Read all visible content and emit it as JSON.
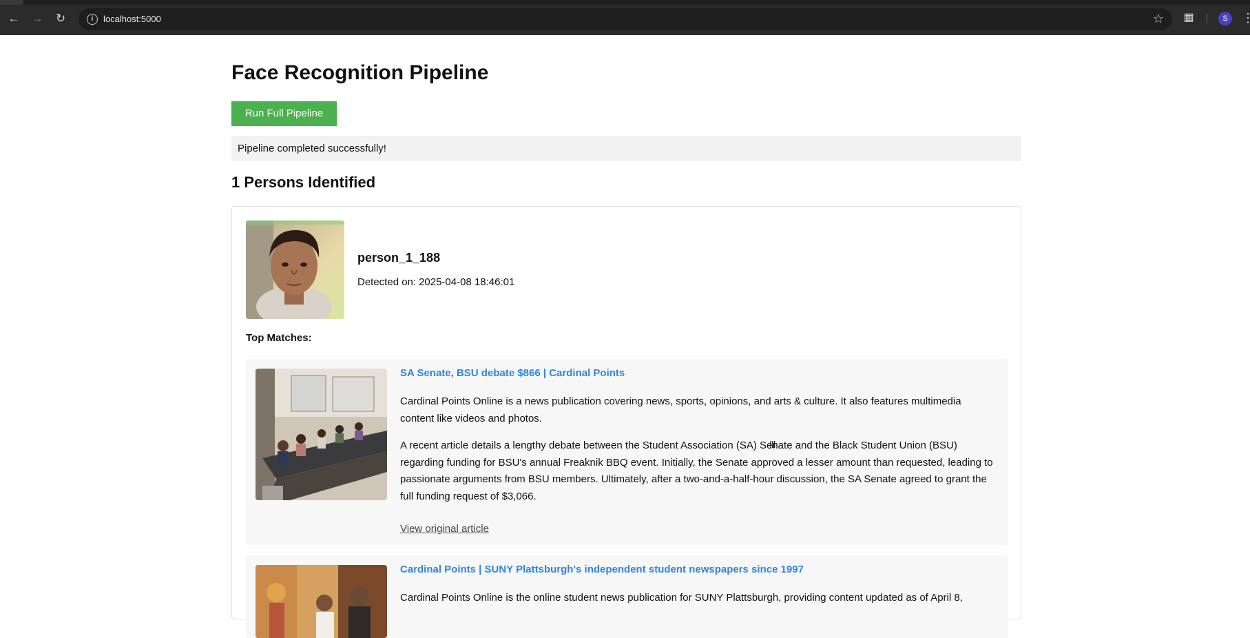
{
  "browser": {
    "url": "localhost:5000",
    "avatar_initial": "S"
  },
  "page": {
    "title": "Face Recognition Pipeline",
    "run_button_label": "Run Full Pipeline",
    "status_message": "Pipeline completed successfully!",
    "persons_heading": "1 Persons Identified"
  },
  "person": {
    "name": "person_1_188",
    "detected_label": "Detected on:",
    "detected_value": "2025-04-08 18:46:01",
    "top_matches_label": "Top Matches:"
  },
  "matches": [
    {
      "title": "SA Senate, BSU debate $866 | Cardinal Points",
      "paragraph_1": "Cardinal Points Online is a news publication covering news, sports, opinions, and arts & culture. It also features multimedia content like videos and photos.",
      "paragraph_2": "A recent article details a lengthy debate between the Student Association (SA) Senate and the Black Student Union (BSU) regarding funding for BSU's annual Freaknik BBQ event. Initially, the Senate approved a lesser amount than requested, leading to passionate arguments from BSU members. Ultimately, after a two-and-a-half-hour discussion, the SA Senate agreed to grant the full funding request of $3,066.",
      "link_label": "View original article"
    },
    {
      "title": "Cardinal Points | SUNY Plattsburgh's independent student newspapers since 1997",
      "paragraph_1": "Cardinal Points Online is the online student news publication for SUNY Plattsburgh, providing content updated as of April 8,"
    }
  ],
  "colors": {
    "run_button": "#4caf50",
    "link_title": "#2e86de",
    "status_bg": "#f2f2f2",
    "match_bg": "#f7f7f7"
  }
}
